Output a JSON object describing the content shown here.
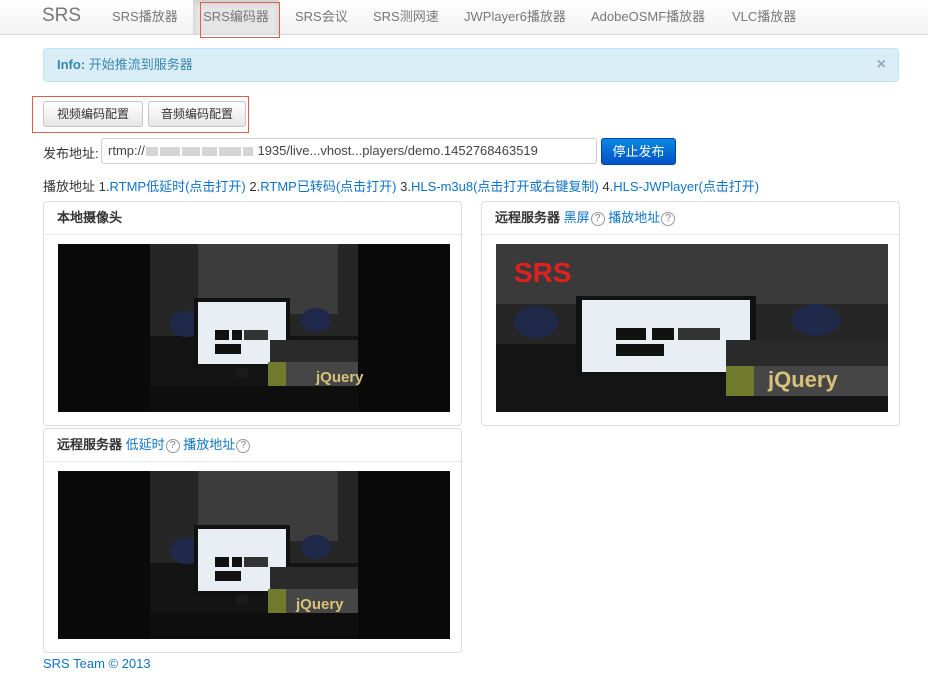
{
  "navbar": {
    "brand": "SRS",
    "items": [
      {
        "label": "SRS播放器"
      },
      {
        "label": "SRS编码器",
        "active": true
      },
      {
        "label": "SRS会议"
      },
      {
        "label": "SRS测网速"
      },
      {
        "label": "JWPlayer6播放器"
      },
      {
        "label": "AdobeOSMF播放器"
      },
      {
        "label": "VLC播放器"
      }
    ]
  },
  "alert": {
    "prefix": "Info:",
    "message": "开始推流到服务器",
    "close": "×"
  },
  "config_buttons": {
    "video": "视频编码配置",
    "audio": "音频编码配置"
  },
  "publish": {
    "label": "发布地址:",
    "url_start": "rtmp://",
    "url_end": "1935/live...vhost...players/demo.1452768463519",
    "stop_button": "停止发布"
  },
  "play": {
    "label": "播放地址",
    "links": [
      {
        "num": "1.",
        "text": "RTMP低延时(点击打开)"
      },
      {
        "num": "2.",
        "text": "RTMP已转码(点击打开)"
      },
      {
        "num": "3.",
        "text": "HLS-m3u8(点击打开或右键复制)"
      },
      {
        "num": "4.",
        "text": "HLS-JWPlayer(点击打开)"
      }
    ]
  },
  "panels": {
    "local": {
      "title": "本地摄像头"
    },
    "remote_transcoded": {
      "title": "远程服务器",
      "link1": "黑屏",
      "link2": "播放地址",
      "help": "?"
    },
    "remote_low_latency": {
      "title": "远程服务器",
      "link1": "低延时",
      "link2": "播放地址",
      "help": "?"
    }
  },
  "video_overlay": {
    "srs_logo": "SRS",
    "book_text": "jQuery"
  },
  "footer": {
    "text": "SRS Team © 2013"
  },
  "colors": {
    "link": "#0e73c8",
    "alert_bg": "#d9edf7",
    "alert_text": "#3a87ad",
    "primary_button": "#0a6fd6",
    "highlight_box": "#d9604c"
  }
}
